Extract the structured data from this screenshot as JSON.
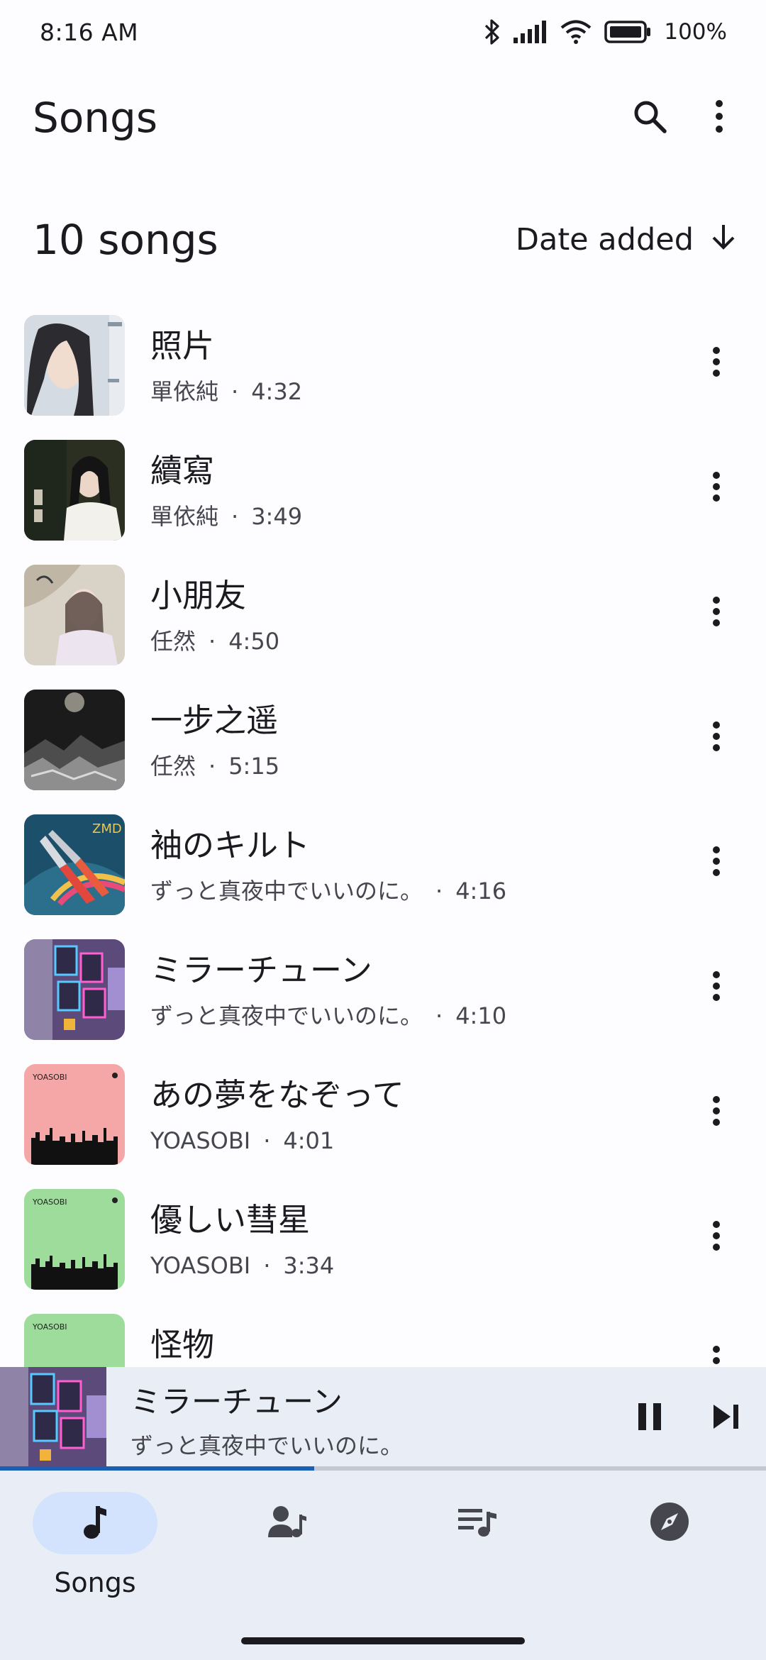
{
  "status_bar": {
    "time": "8:16 AM",
    "battery": "100%",
    "icons": [
      "bluetooth-icon",
      "signal-icon",
      "wifi-icon",
      "battery-icon"
    ]
  },
  "app_bar": {
    "title": "Songs",
    "actions": [
      "search-icon",
      "more-vert-icon"
    ]
  },
  "list_header": {
    "count": "10 songs",
    "sort_label": "Date added",
    "sort_icon": "arrow-down-icon"
  },
  "songs": [
    {
      "title": "照片",
      "artist": "單依純",
      "duration": "4:32"
    },
    {
      "title": "續寫",
      "artist": "單依純",
      "duration": "3:49"
    },
    {
      "title": "小朋友",
      "artist": "任然",
      "duration": "4:50"
    },
    {
      "title": "一步之遥",
      "artist": "任然",
      "duration": "5:15"
    },
    {
      "title": "袖のキルト",
      "artist": "ずっと真夜中でいいのに。",
      "duration": "4:16"
    },
    {
      "title": "ミラーチューン",
      "artist": "ずっと真夜中でいいのに。",
      "duration": "4:10"
    },
    {
      "title": "あの夢をなぞって",
      "artist": "YOASOBI",
      "duration": "4:01"
    },
    {
      "title": "優しい彗星",
      "artist": "YOASOBI",
      "duration": "3:34"
    },
    {
      "title": "怪物",
      "artist": "",
      "duration": ""
    }
  ],
  "meta_separator": "·",
  "mini_player": {
    "title": "ミラーチューン",
    "artist": "ずっと真夜中でいいのに。",
    "progress": 0.41,
    "controls": [
      "pause-icon",
      "skip-next-icon"
    ]
  },
  "bottom_nav": {
    "items": [
      {
        "label": "Songs",
        "icon": "music-note-icon",
        "active": true
      },
      {
        "label": "",
        "icon": "artist-icon",
        "active": false
      },
      {
        "label": "",
        "icon": "playlist-icon",
        "active": false
      },
      {
        "label": "",
        "icon": "explore-icon",
        "active": false
      }
    ]
  },
  "colors": {
    "background": "#fdfcff",
    "surface_container": "#e9eef6",
    "active_pill": "#d3e3fd",
    "accent": "#1a5fb4",
    "text_primary": "#1b1b1f",
    "text_secondary": "#46464f"
  }
}
